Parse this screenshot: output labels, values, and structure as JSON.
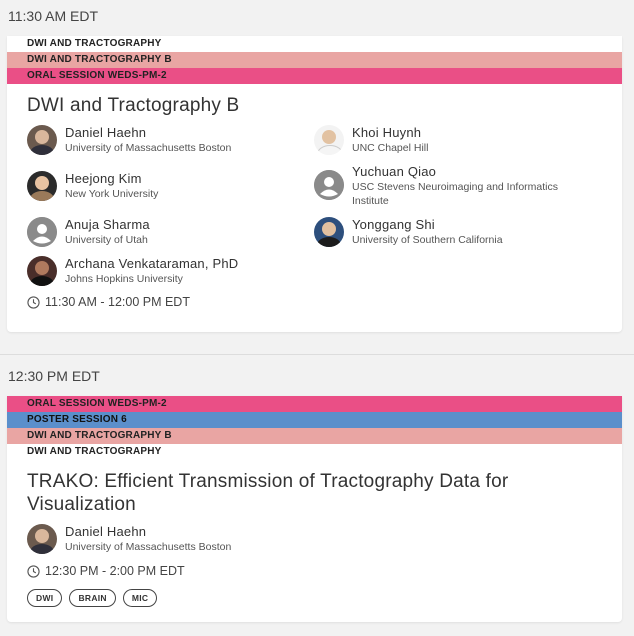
{
  "sessions": [
    {
      "time_header": "11:30 AM EDT",
      "tags": [
        "DWI AND TRACTOGRAPHY",
        "DWI AND TRACTOGRAPHY B",
        "ORAL SESSION WEDS-PM-2"
      ],
      "title": "DWI and Tractography B",
      "people": [
        {
          "name": "Daniel Haehn",
          "affiliation": "University of Massachusetts Boston"
        },
        {
          "name": "Khoi Huynh",
          "affiliation": "UNC Chapel Hill"
        },
        {
          "name": "Heejong Kim",
          "affiliation": "New York University"
        },
        {
          "name": "Yuchuan Qiao",
          "affiliation": "USC Stevens Neuroimaging and Informatics",
          "affiliation2": "Institute"
        },
        {
          "name": "Anuja Sharma",
          "affiliation": "University of Utah"
        },
        {
          "name": "Yonggang Shi",
          "affiliation": "University of Southern California"
        },
        {
          "name": "Archana Venkataraman, PhD",
          "affiliation": "Johns Hopkins University"
        }
      ],
      "time_range": "11:30 AM - 12:00 PM EDT"
    },
    {
      "time_header": "12:30 PM EDT",
      "tags": [
        "ORAL SESSION WEDS-PM-2",
        "POSTER SESSION 6",
        "DWI AND TRACTOGRAPHY B",
        "DWI AND TRACTOGRAPHY"
      ],
      "title_line1": "TRAKO: Efficient Transmission of Tractography Data for",
      "title_line2": "Visualization",
      "people": [
        {
          "name": "Daniel Haehn",
          "affiliation": "University of Massachusetts Boston"
        }
      ],
      "time_range": "12:30 PM - 2:00 PM EDT",
      "chips": [
        "DWI",
        "BRAIN",
        "MIC"
      ]
    }
  ],
  "icons": {
    "clock": "clock-icon",
    "generic_avatar": "user-placeholder-icon"
  },
  "colors": {
    "tag_salmon": "#e9a5a3",
    "tag_pink": "#ea4f86",
    "tag_blue": "#5b8fcb"
  }
}
